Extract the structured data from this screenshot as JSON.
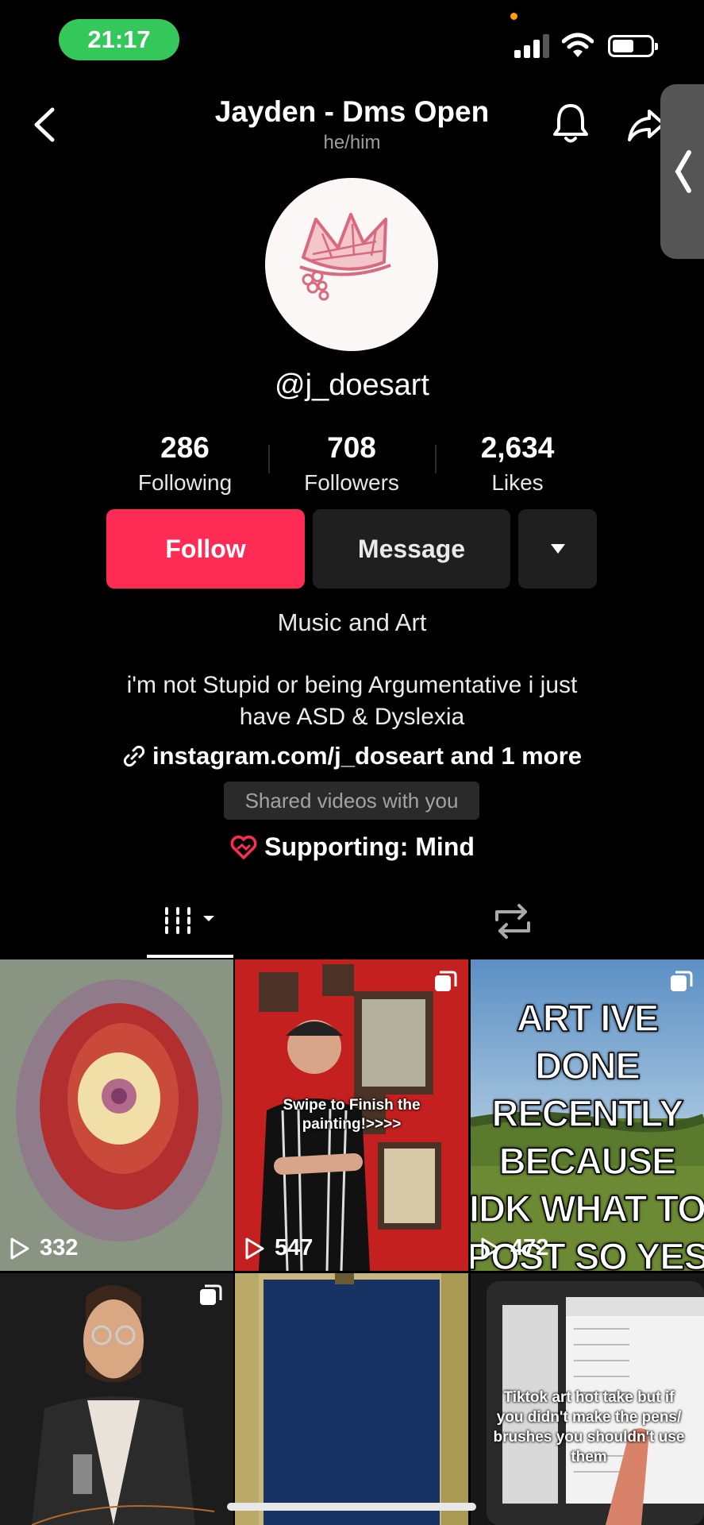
{
  "status_bar": {
    "time": "21:17"
  },
  "header": {
    "title": "Jayden - Dms Open",
    "pronouns": "he/him"
  },
  "profile": {
    "username": "@j_doesart",
    "stats": [
      {
        "value": "286",
        "label": "Following"
      },
      {
        "value": "708",
        "label": "Followers"
      },
      {
        "value": "2,634",
        "label": "Likes"
      }
    ],
    "follow_label": "Follow",
    "message_label": "Message",
    "category": "Music and Art",
    "bio_line1": "i'm not Stupid or being Argumentative i just",
    "bio_line2": "have ASD & Dyslexia",
    "link": "instagram.com/j_doseart",
    "link_more": "and 1 more",
    "shared_label": "Shared videos with you",
    "supporting": "Supporting: Mind"
  },
  "videos": [
    {
      "views": "332",
      "caption": ""
    },
    {
      "views": "547",
      "caption": "Swipe to Finish the painting!>>>>"
    },
    {
      "views": "472",
      "caption": "ART IVE DONE RECENTLY BECAUSE IDK WHAT TO POST SO YES"
    },
    {
      "views": "",
      "caption": ""
    },
    {
      "views": "",
      "caption": ""
    },
    {
      "views": "",
      "caption": "Tiktok art hot take but if you didn't make the pens/ brushes you shouldn't use them"
    }
  ],
  "colors": {
    "follow": "#fe2c55",
    "status_time_bg": "#34c759",
    "background": "#000000"
  },
  "icons": [
    "back-icon",
    "bell-icon",
    "share-icon",
    "link-icon",
    "heart-hands-icon",
    "grid-icon",
    "repost-icon",
    "play-icon",
    "multi-photo-icon"
  ]
}
